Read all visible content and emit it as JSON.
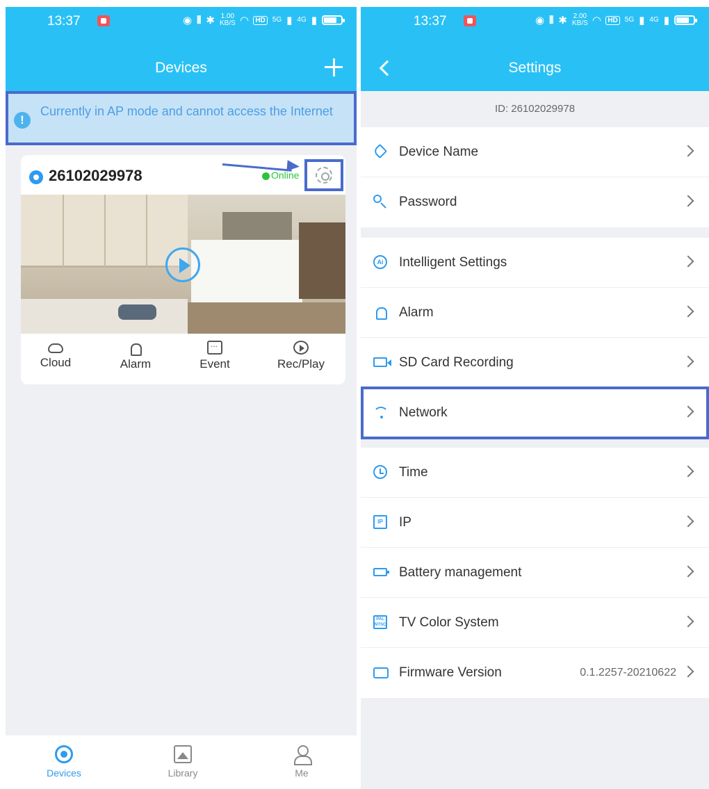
{
  "left": {
    "status": {
      "time": "13:37",
      "speed": "1.00\nKB/S",
      "hd": "HD",
      "sig1": "5G",
      "sig2": "4G"
    },
    "nav": {
      "title": "Devices"
    },
    "banner": {
      "text": "Currently in AP mode and cannot access the Internet"
    },
    "device": {
      "id": "26102029978",
      "status": "Online",
      "actions": [
        {
          "label": "Cloud"
        },
        {
          "label": "Alarm"
        },
        {
          "label": "Event"
        },
        {
          "label": "Rec/Play"
        }
      ]
    },
    "tabs": [
      {
        "label": "Devices"
      },
      {
        "label": "Library"
      },
      {
        "label": "Me"
      }
    ]
  },
  "right": {
    "status": {
      "time": "13:37",
      "speed": "2.00\nKB/S",
      "hd": "HD",
      "sig1": "5G",
      "sig2": "4G"
    },
    "nav": {
      "title": "Settings"
    },
    "id_label": "ID: 26102029978",
    "group1": [
      {
        "label": "Device Name",
        "icon": "tag-icon"
      },
      {
        "label": "Password",
        "icon": "key-icon"
      }
    ],
    "group2": [
      {
        "label": "Intelligent Settings",
        "icon": "ai-icon",
        "icon_text": "Ai"
      },
      {
        "label": "Alarm",
        "icon": "alarm-icon"
      },
      {
        "label": "SD Card Recording",
        "icon": "sd-card-icon"
      },
      {
        "label": "Network",
        "icon": "wifi-icon"
      }
    ],
    "group3": [
      {
        "label": "Time",
        "icon": "clock-icon"
      },
      {
        "label": "IP",
        "icon": "ip-icon",
        "icon_text": "IP"
      },
      {
        "label": "Battery management",
        "icon": "battery-icon"
      },
      {
        "label": "TV Color System",
        "icon": "tv-icon",
        "icon_text": "PAL NTSC"
      },
      {
        "label": "Firmware Version",
        "icon": "firmware-icon",
        "value": "0.1.2257-20210622"
      }
    ]
  },
  "colors": {
    "accent": "#29c1f5",
    "highlight": "#4a6bcc",
    "online": "#2bc43a",
    "icon_blue": "#2e9bf0"
  }
}
